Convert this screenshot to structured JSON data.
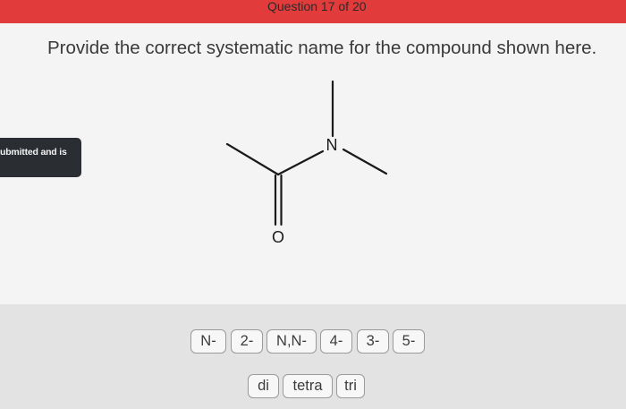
{
  "header": {
    "question_counter": "Question 17 of 20",
    "bar_color": "#e23b3b"
  },
  "question": {
    "prompt": "Provide the correct systematic name for the compound shown here."
  },
  "toast": {
    "text": "ubmitted and is"
  },
  "molecule": {
    "atom_labels": {
      "nitrogen": "N",
      "oxygen": "O"
    }
  },
  "answer_tiles": {
    "row1": [
      "N-",
      "2-",
      "N,N-",
      "4-",
      "3-",
      "5-"
    ],
    "row2": [
      "di",
      "tetra",
      "tri"
    ]
  }
}
